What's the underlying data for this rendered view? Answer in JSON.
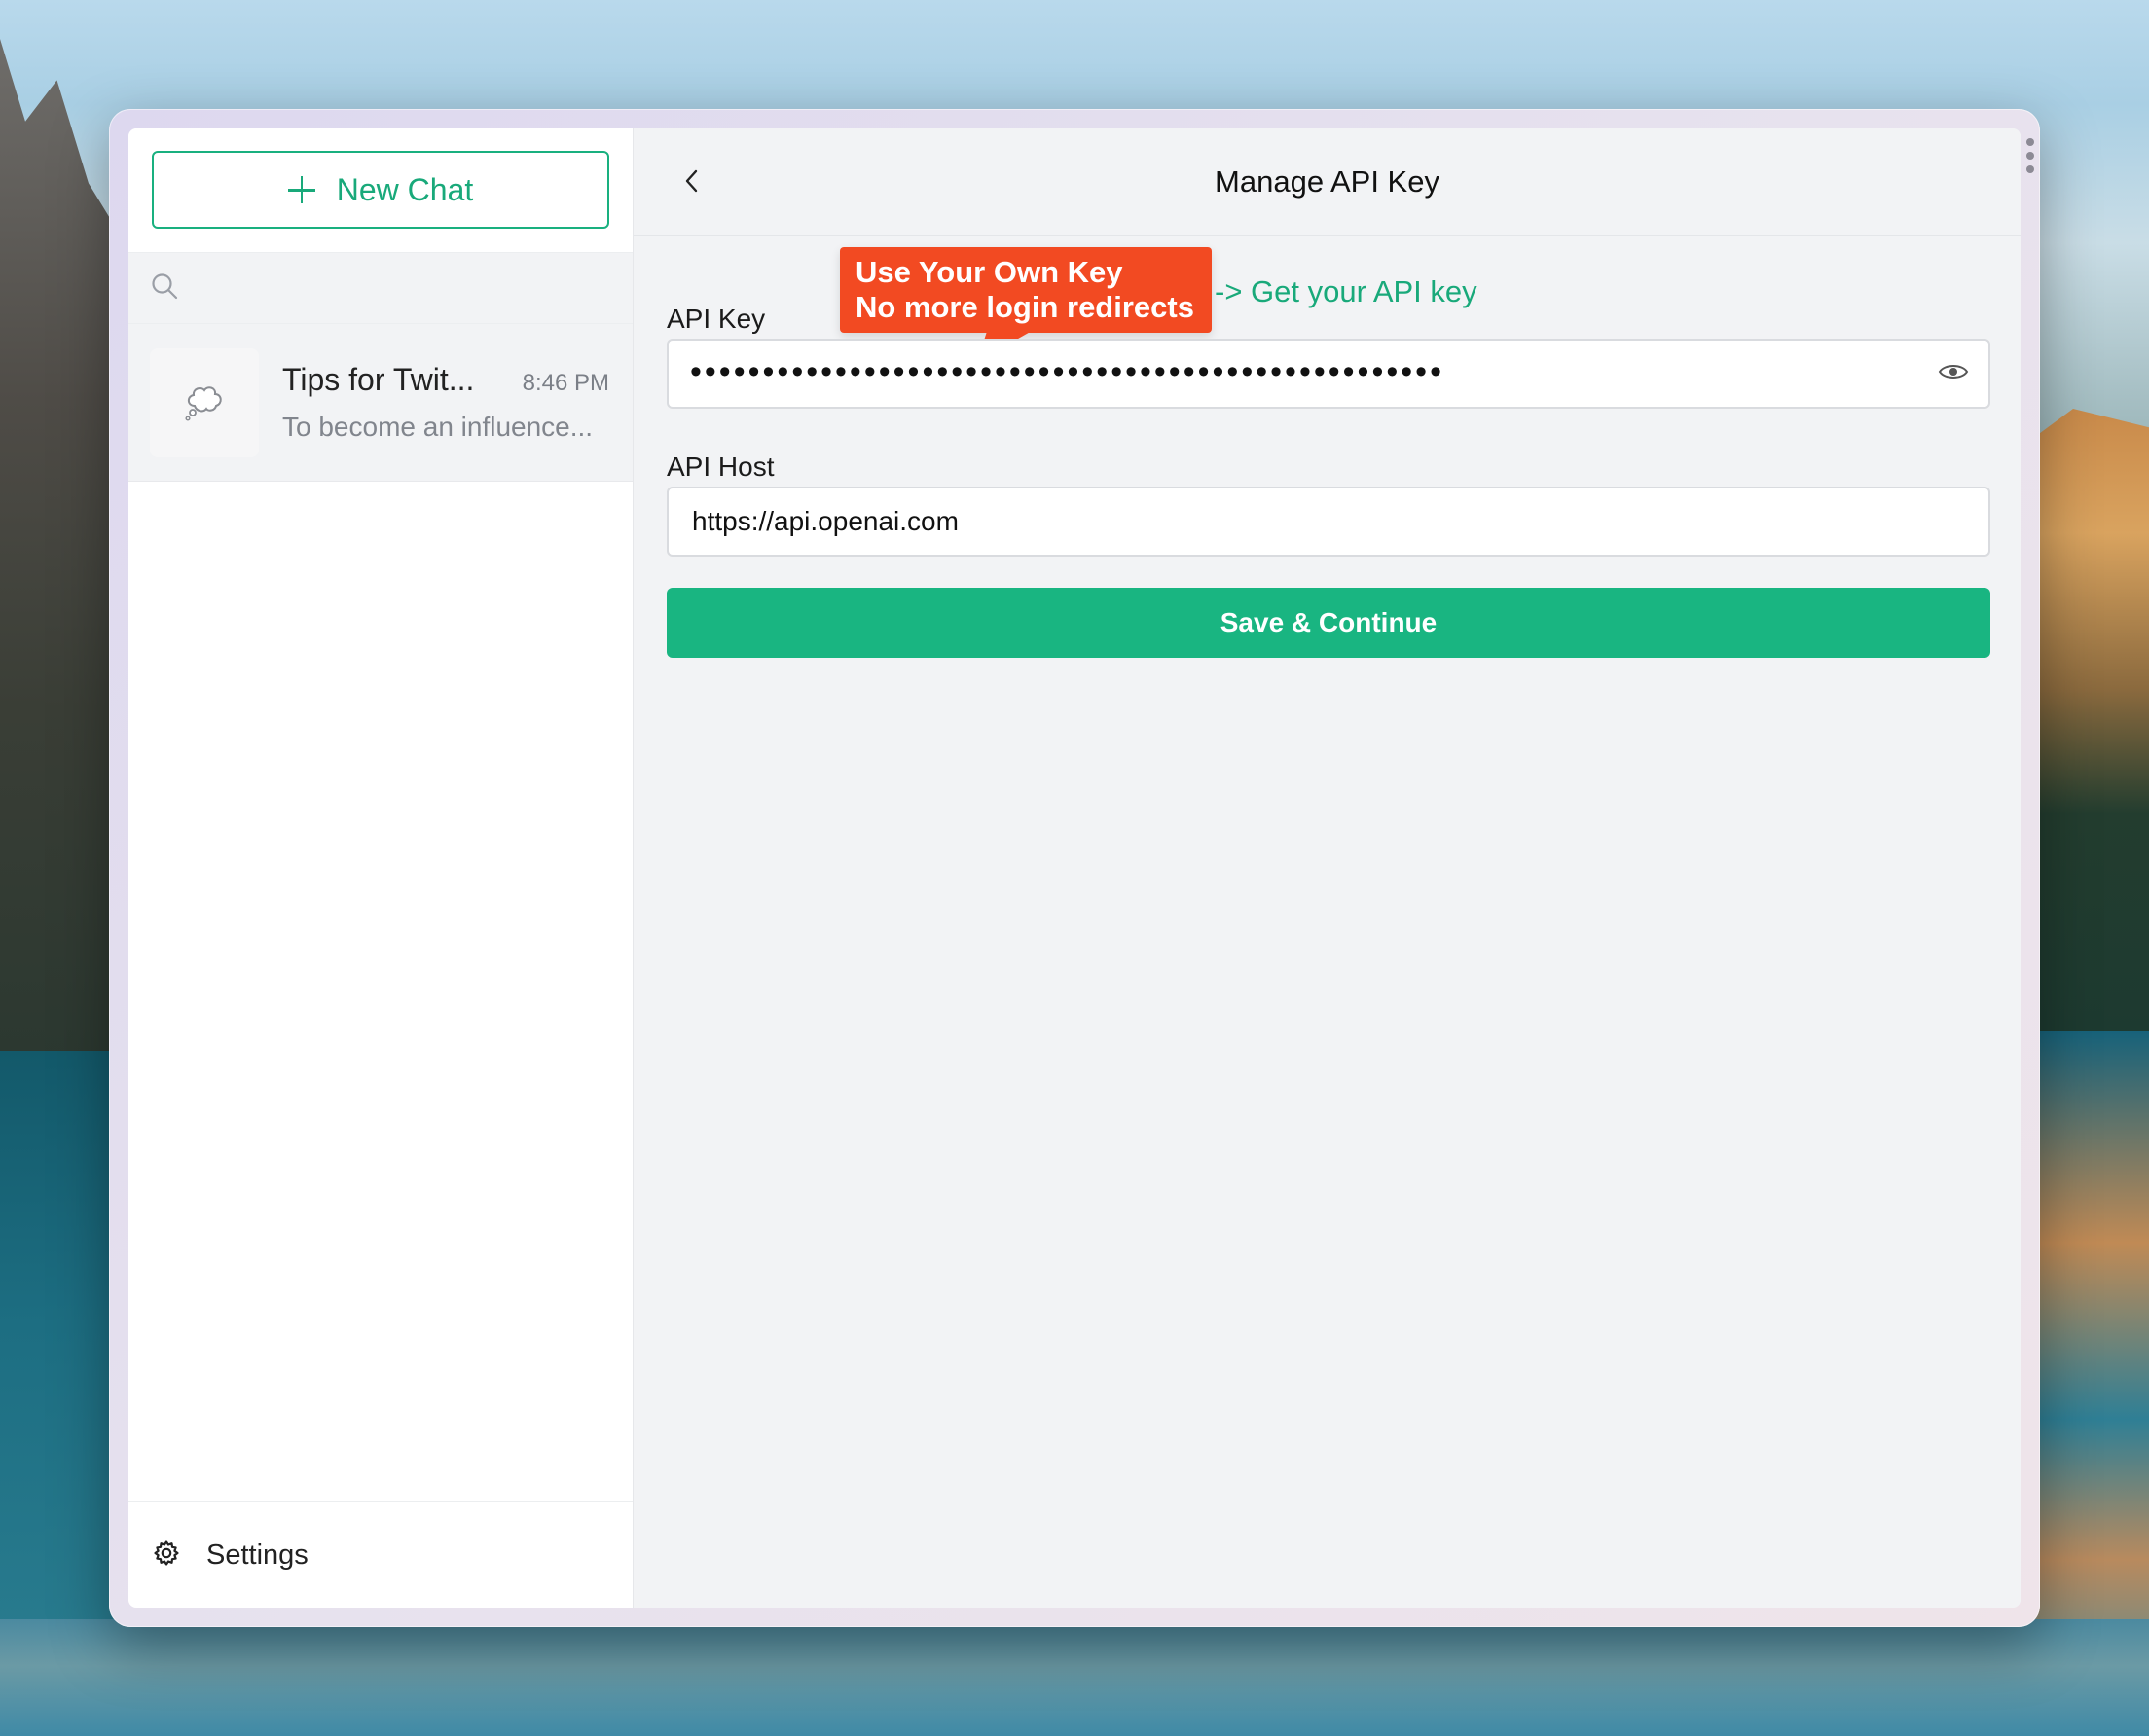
{
  "sidebar": {
    "new_chat_label": "New Chat",
    "search_placeholder": "",
    "chats": [
      {
        "title": "Tips for Twit...",
        "time": "8:46 PM",
        "preview": "To become an influence..."
      }
    ],
    "settings_label": "Settings"
  },
  "main": {
    "title": "Manage API Key",
    "callout": {
      "line1": "Use Your Own Key",
      "line2": "No more login redirects"
    },
    "get_key_link": "-> Get your API key",
    "api_key": {
      "label": "API Key",
      "masked_value": "••••••••••••••••••••••••••••••••••••••••••••••••••••"
    },
    "api_host": {
      "label": "API Host",
      "value": "https://api.openai.com"
    },
    "save_label": "Save & Continue"
  },
  "colors": {
    "accent": "#19b581",
    "callout": "#f24a22"
  },
  "icons": {
    "new_chat": "plus-icon",
    "search": "search-icon",
    "avatar": "thought-bubble-icon",
    "settings": "gear-icon",
    "back": "chevron-left-icon",
    "reveal": "eye-icon"
  }
}
